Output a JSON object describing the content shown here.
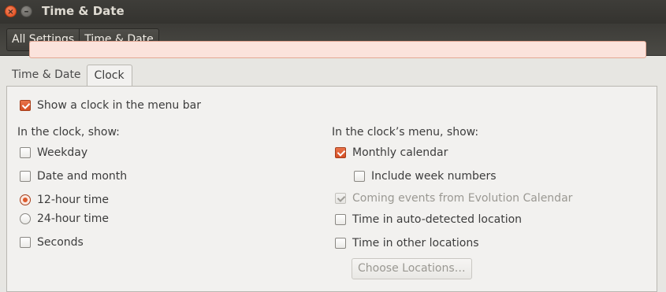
{
  "window": {
    "title": "Time & Date",
    "close_glyph": "×",
    "minimize_glyph": "–"
  },
  "toolbar": {
    "breadcrumbs": [
      "All Settings",
      "Time & Date"
    ]
  },
  "tabs": [
    {
      "label": "Time & Date",
      "active": false
    },
    {
      "label": "Clock",
      "active": true
    }
  ],
  "clock": {
    "show_in_menubar": {
      "label": "Show a clock in the menu bar",
      "checked": true
    },
    "in_clock": {
      "title": "In the clock, show:",
      "weekday": {
        "label": "Weekday",
        "checked": false
      },
      "date_month": {
        "label": "Date and month",
        "checked": false
      },
      "time_12h": {
        "label": "12-hour time",
        "selected": true
      },
      "time_24h": {
        "label": "24-hour time",
        "selected": false
      },
      "seconds": {
        "label": "Seconds",
        "checked": false
      }
    },
    "in_menu": {
      "title": "In the clock’s menu, show:",
      "monthly_calendar": {
        "label": "Monthly calendar",
        "checked": true
      },
      "week_numbers": {
        "label": "Include week numbers",
        "checked": false
      },
      "coming_events": {
        "label": "Coming events from Evolution Calendar",
        "checked": true,
        "disabled": true
      },
      "auto_location": {
        "label": "Time in auto-detected location",
        "checked": false
      },
      "other_locations": {
        "label": "Time in other locations",
        "checked": false
      },
      "choose_locations_button": "Choose Locations…"
    }
  },
  "colors": {
    "accent": "#dd4814",
    "titlebar": "#3c3b37",
    "highlight_bg": "#fbe3dc"
  }
}
